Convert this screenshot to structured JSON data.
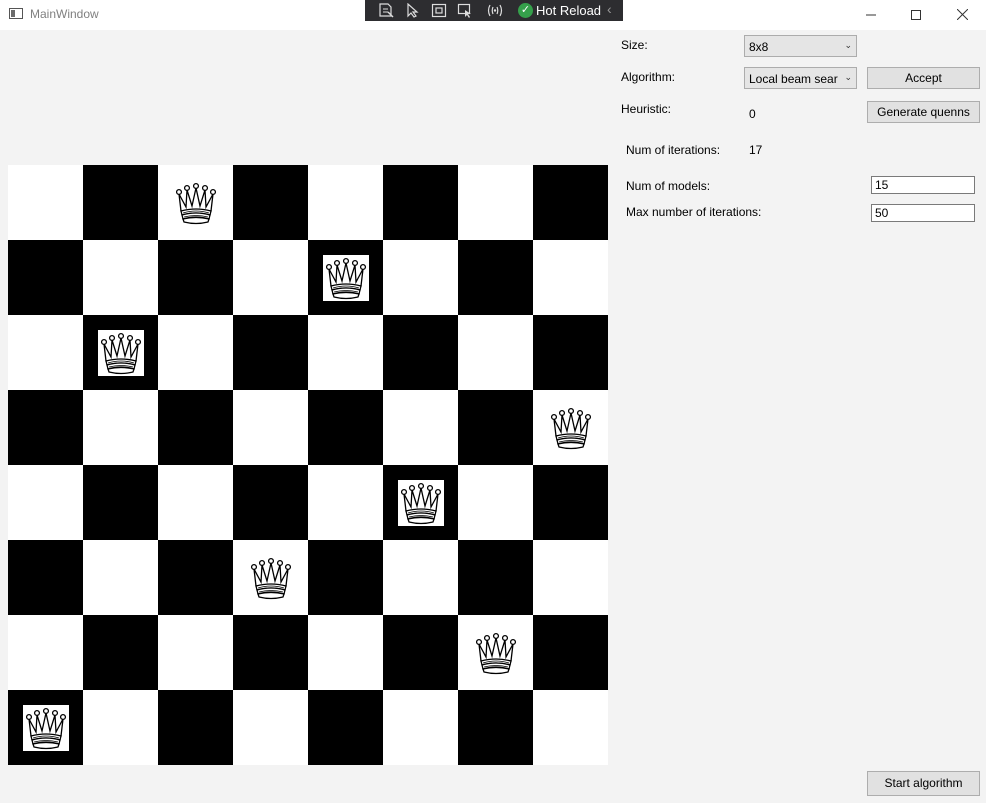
{
  "window": {
    "title": "MainWindow"
  },
  "debug_toolbar": {
    "hot_reload_label": "Hot Reload"
  },
  "window_controls": {
    "minimize": "—",
    "maximize": "☐",
    "close": "✕"
  },
  "colors": {
    "light_square": "#ffffff",
    "dark_square": "#000000",
    "hot_reload_ok": "#35a04b"
  },
  "board": {
    "size": 8,
    "queen_icon": "queen-chess-icon",
    "queen_positions": [
      {
        "row": 0,
        "col": 2
      },
      {
        "row": 1,
        "col": 4
      },
      {
        "row": 2,
        "col": 1
      },
      {
        "row": 3,
        "col": 7
      },
      {
        "row": 4,
        "col": 5
      },
      {
        "row": 5,
        "col": 3
      },
      {
        "row": 6,
        "col": 6
      },
      {
        "row": 7,
        "col": 0
      }
    ]
  },
  "controls": {
    "size_label": "Size:",
    "size_value": "8x8",
    "algorithm_label": "Algorithm:",
    "algorithm_value": "Local beam sear",
    "accept_button": "Accept",
    "heuristic_label": "Heuristic:",
    "heuristic_value": "0",
    "generate_button": "Generate quenns",
    "iterations_label": "Num of iterations:",
    "iterations_value": "17",
    "models_label": "Num of models:",
    "models_value": "15",
    "max_iter_label": "Max number of iterations:",
    "max_iter_value": "50",
    "start_button": "Start algorithm"
  }
}
